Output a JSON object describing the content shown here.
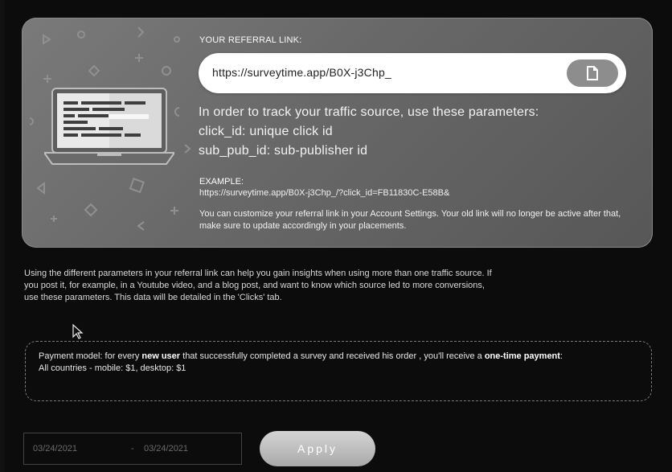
{
  "referral": {
    "title": "YOUR REFERRAL LINK:",
    "link": "https://surveytime.app/B0X-j3Chp_",
    "copy_icon": "copy-icon",
    "params_intro": "In order to track your traffic source, use these parameters:",
    "param_click": "click_id: unique click id",
    "param_sub": "sub_pub_id: sub-publisher id",
    "example_label": "EXAMPLE:",
    "example_url": "https://surveytime.app/B0X-j3Chp_/?click_id=FB11830C-E58B&",
    "note": "You can customize your referral link in your Account Settings. Your old link will no longer be active after that, make sure to update accordingly in your placements."
  },
  "info_text": "Using the different parameters in your referral link can help you gain insights when using more than one traffic source. If you post it, for example, in a Youtube video, and a blog post, and want to know which source led to more conversions, use these parameters. This data will be detailed in the 'Clicks' tab.",
  "payment": {
    "part1": "Payment model: for every ",
    "bold1": "new user",
    "part2": " that successfully completed a survey and received his order , you'll receive a ",
    "bold2": "one-time payment",
    "part3": ":",
    "line2": "All countries - mobile: $1, desktop: $1"
  },
  "date_range": {
    "from": "03/24/2021",
    "separator": "-",
    "to": "03/24/2021"
  },
  "apply_label": "Apply"
}
